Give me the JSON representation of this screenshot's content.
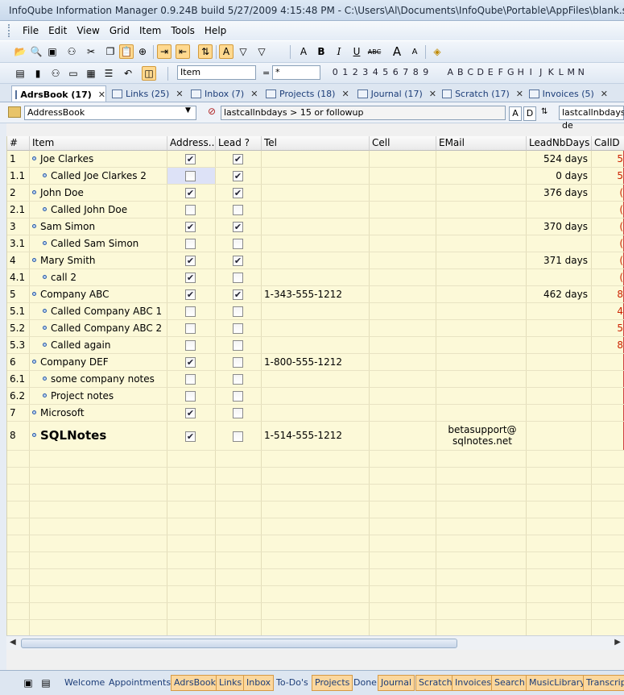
{
  "window": {
    "title": "InfoQube Information Manager 0.9.24B  build 5/27/2009 4:15:48 PM - C:\\Users\\Al\\Documents\\InfoQube\\Portable\\AppFiles\\blank.sntemplate"
  },
  "menu": [
    "File",
    "Edit",
    "View",
    "Grid",
    "Item",
    "Tools",
    "Help"
  ],
  "toolbar2": {
    "field_select": "Item",
    "equals": "=",
    "value_input": "*",
    "digits": [
      "0",
      "1",
      "2",
      "3",
      "4",
      "5",
      "6",
      "7",
      "8",
      "9"
    ],
    "letters": [
      "A",
      "B",
      "C",
      "D",
      "E",
      "F",
      "G",
      "H",
      "I",
      "J",
      "K",
      "L",
      "M",
      "N"
    ]
  },
  "tabs": [
    {
      "label": "AdrsBook (17)",
      "active": true
    },
    {
      "label": "Links (25)"
    },
    {
      "label": "Inbox (7)"
    },
    {
      "label": "Projects (18)"
    },
    {
      "label": "Journal (17)"
    },
    {
      "label": "Scratch (17)"
    },
    {
      "label": "Invoices (5)"
    }
  ],
  "filterbar": {
    "grid_name": "AddressBook",
    "filter": "lastcallnbdays > 15 or followup",
    "sort_a": "A",
    "sort_d": "D",
    "sort_field": "lastcallnbdays de"
  },
  "columns": {
    "num": "#",
    "item": "Item",
    "address": "Address...",
    "lead": "Lead ?",
    "tel": "Tel",
    "cell": "Cell",
    "email": "EMail",
    "leadnbdays": "LeadNbDays",
    "calld": "CallD"
  },
  "rows": [
    {
      "num": "1",
      "item": "Joe Clarkes",
      "indent": 0,
      "address": true,
      "lead": true,
      "tel": "",
      "email": "",
      "days": "524 days",
      "calld": "5"
    },
    {
      "num": "1.1",
      "item": "Called Joe Clarkes 2",
      "indent": 1,
      "address": false,
      "lead": true,
      "tel": "",
      "email": "",
      "days": "0 days",
      "calld": "5",
      "selected": true
    },
    {
      "num": "2",
      "item": "John Doe",
      "indent": 0,
      "address": true,
      "lead": true,
      "tel": "",
      "email": "",
      "days": "376 days",
      "calld": "("
    },
    {
      "num": "2.1",
      "item": "Called John Doe",
      "indent": 1,
      "address": false,
      "lead": false,
      "tel": "",
      "email": "",
      "days": "",
      "calld": "("
    },
    {
      "num": "3",
      "item": "Sam Simon",
      "indent": 0,
      "address": true,
      "lead": true,
      "tel": "",
      "email": "",
      "days": "370 days",
      "calld": "("
    },
    {
      "num": "3.1",
      "item": "Called Sam Simon",
      "indent": 1,
      "address": false,
      "lead": false,
      "tel": "",
      "email": "",
      "days": "",
      "calld": "("
    },
    {
      "num": "4",
      "item": "Mary Smith",
      "indent": 0,
      "address": true,
      "lead": true,
      "tel": "",
      "email": "",
      "days": "371 days",
      "calld": "("
    },
    {
      "num": "4.1",
      "item": "call 2",
      "indent": 1,
      "address": true,
      "lead": false,
      "tel": "",
      "email": "",
      "days": "",
      "calld": "("
    },
    {
      "num": "5",
      "item": "Company ABC",
      "indent": 0,
      "address": true,
      "lead": true,
      "tel": "1-343-555-1212",
      "email": "",
      "days": "462 days",
      "calld": "8"
    },
    {
      "num": "5.1",
      "item": "Called Company ABC 1",
      "indent": 1,
      "address": false,
      "lead": false,
      "tel": "",
      "email": "",
      "days": "",
      "calld": "4"
    },
    {
      "num": "5.2",
      "item": "Called Company ABC 2",
      "indent": 1,
      "address": false,
      "lead": false,
      "tel": "",
      "email": "",
      "days": "",
      "calld": "5"
    },
    {
      "num": "5.3",
      "item": "Called again",
      "indent": 1,
      "address": false,
      "lead": false,
      "tel": "",
      "email": "",
      "days": "",
      "calld": "8"
    },
    {
      "num": "6",
      "item": "Company DEF",
      "indent": 0,
      "address": true,
      "lead": false,
      "tel": "1-800-555-1212",
      "email": "",
      "days": "",
      "calld": ""
    },
    {
      "num": "6.1",
      "item": "some company notes",
      "indent": 1,
      "address": false,
      "lead": false,
      "tel": "",
      "email": "",
      "days": "",
      "calld": ""
    },
    {
      "num": "6.2",
      "item": "Project notes",
      "indent": 1,
      "address": false,
      "lead": false,
      "tel": "",
      "email": "",
      "days": "",
      "calld": ""
    },
    {
      "num": "7",
      "item": "Microsoft",
      "indent": 0,
      "address": true,
      "lead": false,
      "tel": "",
      "email": "",
      "days": "",
      "calld": ""
    },
    {
      "num": "8",
      "item": "SQLNotes",
      "indent": 0,
      "address": true,
      "lead": false,
      "tel": "1-514-555-1212",
      "email": "betasupport@ sqlnotes.net",
      "days": "",
      "calld": "",
      "big": true
    }
  ],
  "bottom_tabs": [
    {
      "label": "Welcome"
    },
    {
      "label": "Appointments"
    },
    {
      "label": "AdrsBook",
      "hl": true
    },
    {
      "label": "Links",
      "hl": true
    },
    {
      "label": "Inbox",
      "hl": true
    },
    {
      "label": "To-Do's"
    },
    {
      "label": "Projects",
      "hl": true
    },
    {
      "label": "Done"
    },
    {
      "label": "Journal",
      "hl": true
    },
    {
      "label": "Scratch",
      "hl": true
    },
    {
      "label": "Invoices",
      "hl": true
    },
    {
      "label": "Search",
      "hl": true
    },
    {
      "label": "MusicLibrary",
      "hl": true
    },
    {
      "label": "Transcrip",
      "hl": true
    }
  ],
  "colors": {
    "grid_bg": "#fcf9d8",
    "accent": "#fbd79d",
    "calld_text": "#cc2200"
  }
}
